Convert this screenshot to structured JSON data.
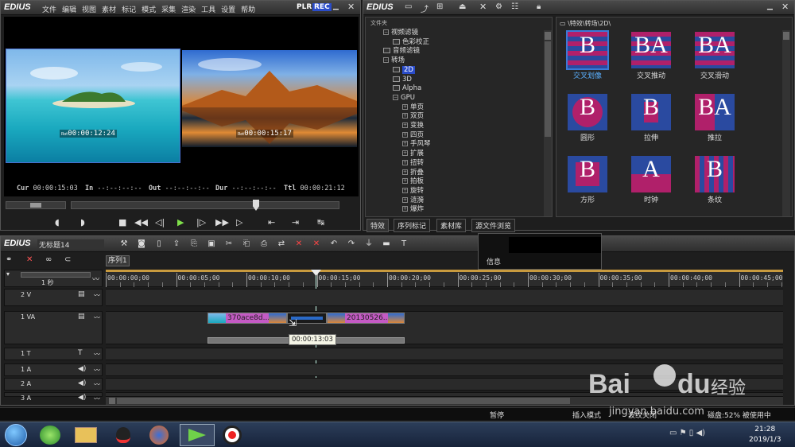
{
  "app": {
    "logo": "EDIUS"
  },
  "menu": [
    "文件",
    "编辑",
    "视图",
    "素材",
    "标记",
    "模式",
    "采集",
    "渲染",
    "工具",
    "设置",
    "帮助"
  ],
  "player": {
    "plr": "PLR",
    "rec": "REC",
    "left_tc_prefix": "Rot",
    "left_tc": "00:00:12:24",
    "right_tc_prefix": "Rot",
    "right_tc": "00:00:15:17",
    "cur_label": "Cur",
    "cur": "00:00:15:03",
    "in_label": "In",
    "in": "--:--:--:--",
    "out_label": "Out",
    "out": "--:--:--:--",
    "dur_label": "Dur",
    "dur": "--:--:--:--",
    "ttl_label": "Ttl",
    "ttl": "00:00:21:12"
  },
  "effects": {
    "logo": "EDIUS",
    "folder_header": "文件夹",
    "path": "\\特效\\转场\\2D\\",
    "tree": [
      {
        "indent": 1,
        "kind": "minus",
        "label": "视频滤镜"
      },
      {
        "indent": 2,
        "kind": "leaf",
        "label": "色彩校正"
      },
      {
        "indent": 1,
        "kind": "leaf",
        "label": "音频滤镜"
      },
      {
        "indent": 1,
        "kind": "minus",
        "label": "转场"
      },
      {
        "indent": 2,
        "kind": "leaf",
        "label": "2D",
        "selected": true
      },
      {
        "indent": 2,
        "kind": "leaf",
        "label": "3D"
      },
      {
        "indent": 2,
        "kind": "leaf",
        "label": "Alpha"
      },
      {
        "indent": 2,
        "kind": "minus",
        "label": "GPU"
      },
      {
        "indent": 3,
        "kind": "plus",
        "label": "单页"
      },
      {
        "indent": 3,
        "kind": "plus",
        "label": "双页"
      },
      {
        "indent": 3,
        "kind": "plus",
        "label": "变换"
      },
      {
        "indent": 3,
        "kind": "plus",
        "label": "四页"
      },
      {
        "indent": 3,
        "kind": "plus",
        "label": "手风琴"
      },
      {
        "indent": 3,
        "kind": "plus",
        "label": "扩展"
      },
      {
        "indent": 3,
        "kind": "plus",
        "label": "扭转"
      },
      {
        "indent": 3,
        "kind": "plus",
        "label": "折叠"
      },
      {
        "indent": 3,
        "kind": "plus",
        "label": "拍板"
      },
      {
        "indent": 3,
        "kind": "plus",
        "label": "旋转"
      },
      {
        "indent": 3,
        "kind": "plus",
        "label": "涟漪"
      },
      {
        "indent": 3,
        "kind": "plus",
        "label": "爆炸"
      }
    ],
    "thumbs": [
      {
        "label": "交叉划像",
        "letter": "B",
        "selected": true,
        "style": "stripe"
      },
      {
        "label": "交叉推动",
        "letter": "BA",
        "style": "stripe"
      },
      {
        "label": "交叉滑动",
        "letter": "BA",
        "style": "stripe"
      },
      {
        "label": "圆形",
        "letter": "B",
        "style": "circle"
      },
      {
        "label": "拉伸",
        "letter": "B",
        "style": "stretch"
      },
      {
        "label": "推拉",
        "letter": "BA",
        "style": "push"
      },
      {
        "label": "方形",
        "letter": "B",
        "style": "square"
      },
      {
        "label": "时钟",
        "letter": "A",
        "style": "clock"
      },
      {
        "label": "条纹",
        "letter": "B",
        "style": "vstripe"
      }
    ],
    "tabs": [
      "特效",
      "序列标记",
      "素材库",
      "源文件浏览"
    ]
  },
  "info_panel": {
    "label": "信息"
  },
  "timeline": {
    "logo": "EDIUS",
    "project": "无标题14",
    "sequence_tab": "序列1",
    "scale": "1 秒",
    "ruler": [
      "00:00:00;00",
      "00:00:05;00",
      "00:00:10;00",
      "00:00:15;00",
      "00:00:20;00",
      "00:00:25;00",
      "00:00:30;00",
      "00:00:35;00",
      "00:00:40;00",
      "00:00:45;00"
    ],
    "tracks": [
      {
        "name": "2 V",
        "type": "V"
      },
      {
        "name": "1 VA",
        "type": "VA"
      },
      {
        "name": "1 T",
        "type": "T"
      },
      {
        "name": "1 A",
        "type": "A"
      },
      {
        "name": "2 A",
        "type": "A"
      },
      {
        "name": "3 A",
        "type": "A"
      }
    ],
    "clip1": "370ace8d...",
    "clip2": "20130526...",
    "tooltip": "00:00:13:03"
  },
  "status": {
    "pause": "暂停",
    "insert": "插入模式",
    "ripple": "波纹关闭",
    "disk": "磁盘:52% 被使用中"
  },
  "taskbar": {
    "time": "21:28",
    "date": "2019/1/3"
  },
  "watermark": {
    "brand": "Bai",
    "paw": "du",
    "suffix": "经验",
    "url": "jingyan.baidu.com"
  }
}
